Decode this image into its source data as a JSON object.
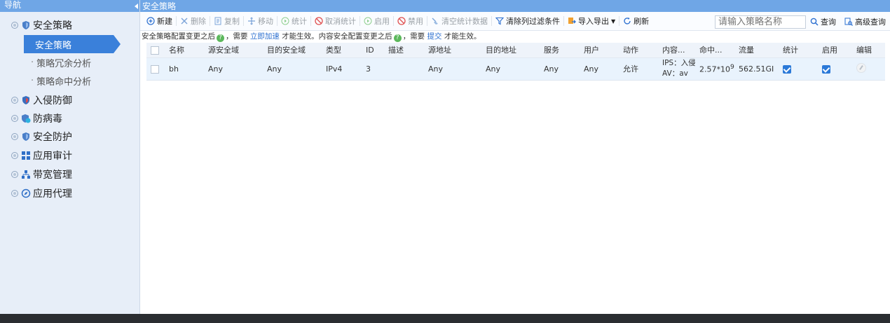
{
  "nav": {
    "header": "导航",
    "groups": [
      {
        "label": "安全策略",
        "icon": "shield-icon"
      },
      {
        "label": "入侵防御",
        "icon": "shield-check-icon"
      },
      {
        "label": "防病毒",
        "icon": "antivirus-icon"
      },
      {
        "label": "安全防护",
        "icon": "shield-icon"
      },
      {
        "label": "应用审计",
        "icon": "grid-icon"
      },
      {
        "label": "带宽管理",
        "icon": "org-chart-icon"
      },
      {
        "label": "应用代理",
        "icon": "compass-icon"
      }
    ],
    "sub_items": [
      {
        "label": "安全策略",
        "active": true
      },
      {
        "label": "策略冗余分析",
        "active": false
      },
      {
        "label": "策略命中分析",
        "active": false
      }
    ]
  },
  "main": {
    "title": "安全策略",
    "toolbar": {
      "new": "新建",
      "delete": "删除",
      "copy": "复制",
      "move": "移动",
      "stats": "统计",
      "cancel_stats": "取消统计",
      "enable": "启用",
      "disable": "禁用",
      "clear_stats": "清空统计数据",
      "clear_filters": "清除列过滤条件",
      "import_export": "导入导出",
      "refresh": "刷新"
    },
    "search": {
      "placeholder": "请输入策略名称",
      "query": "查询",
      "advanced": "高级查询"
    },
    "notice": {
      "part1": "安全策略配置变更之后",
      "part2": "，需要",
      "link1": "立即加速",
      "part3": "才能生效。内容安全配置变更之后",
      "part4": "，需要",
      "link2": "提交",
      "part5": "才能生效。"
    },
    "table": {
      "headers": [
        "名称",
        "源安全域",
        "目的安全域",
        "类型",
        "ID",
        "描述",
        "源地址",
        "目的地址",
        "服务",
        "用户",
        "动作",
        "内容...",
        "命中...",
        "流量",
        "统计",
        "启用",
        "编辑"
      ],
      "rows": [
        {
          "name": "bh",
          "src_zone": "Any",
          "dst_zone": "Any",
          "type": "IPv4",
          "id": "3",
          "desc": "",
          "src_addr": "Any",
          "dst_addr": "Any",
          "service": "Any",
          "user": "Any",
          "action": "允许",
          "content_ips": "IPS：入侵",
          "content_av": "AV：av",
          "hits_base": "2.57*10",
          "hits_exp": "9",
          "traffic": "562.51GI",
          "stats": true,
          "enabled": true
        }
      ]
    }
  }
}
